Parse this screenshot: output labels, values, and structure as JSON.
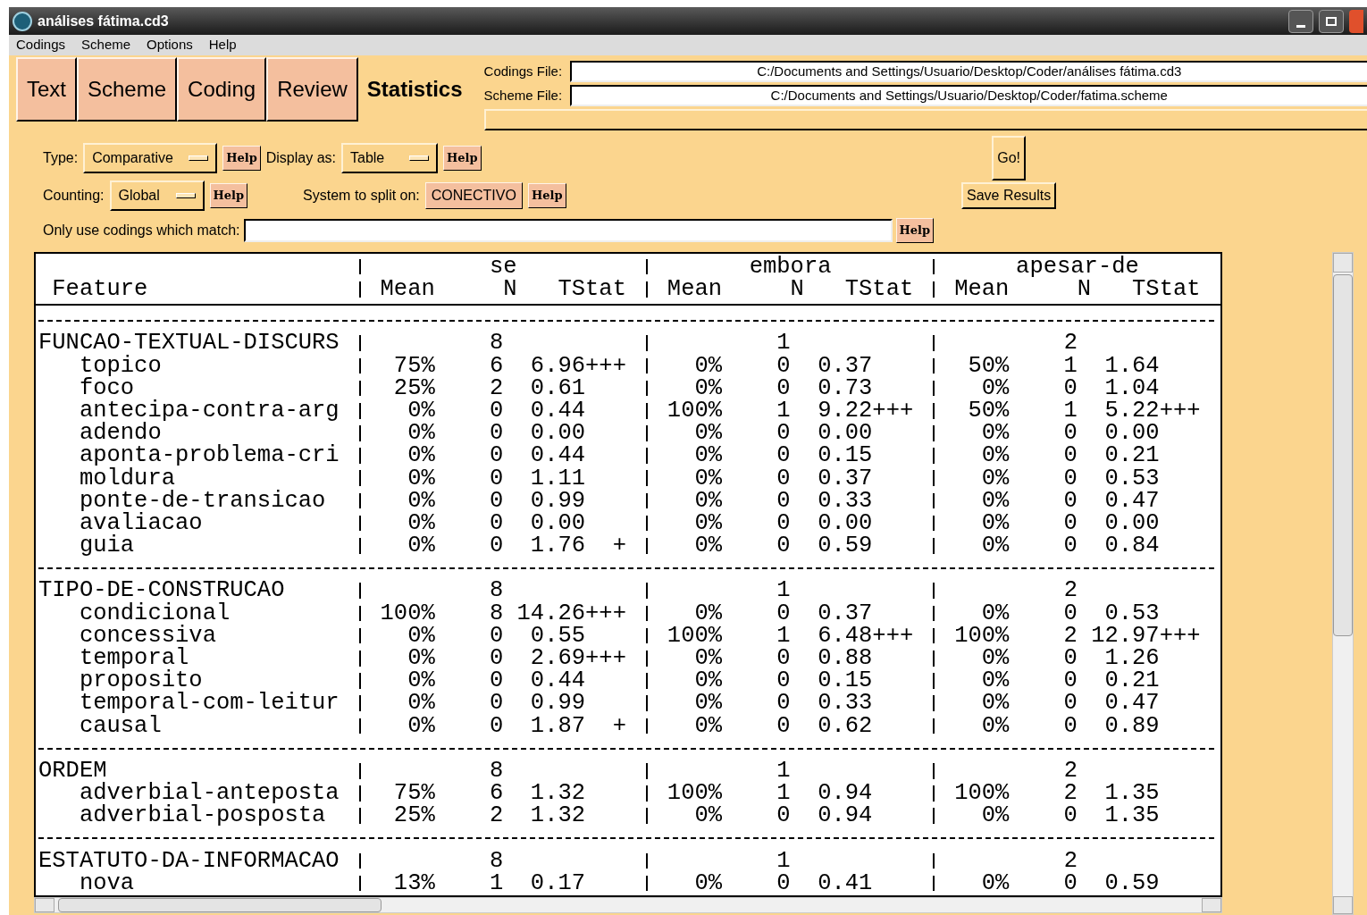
{
  "window": {
    "title": "análises fátima.cd3"
  },
  "menu": [
    "Codings",
    "Scheme",
    "Options",
    "Help"
  ],
  "tabs": [
    {
      "label": "Text",
      "selected": false
    },
    {
      "label": "Scheme",
      "selected": false
    },
    {
      "label": "Coding",
      "selected": false
    },
    {
      "label": "Review",
      "selected": false
    },
    {
      "label": "Statistics",
      "selected": true
    }
  ],
  "files": [
    {
      "label": "Codings File:",
      "value": "C:/Documents and Settings/Usuario/Desktop/Coder/análises fátima.cd3"
    },
    {
      "label": "Scheme File:",
      "value": "C:/Documents and Settings/Usuario/Desktop/Coder/fatima.scheme"
    }
  ],
  "controls": {
    "type_label": "Type:",
    "type_value": "Comparative",
    "display_label": "Display as:",
    "display_value": "Table",
    "counting_label": "Counting:",
    "counting_value": "Global",
    "split_label": "System to split on:",
    "split_value": "CONECTIVO",
    "match_label": "Only use codings which match:",
    "helps": [
      "Help",
      "Help",
      "Help",
      "Help",
      "Help"
    ],
    "go": "Go!",
    "save": "Save Results"
  },
  "table": {
    "feature_heading": "Feature",
    "columns": [
      {
        "name": "se",
        "subheadings": [
          "Mean",
          "N",
          "TStat"
        ]
      },
      {
        "name": "embora",
        "subheadings": [
          "Mean",
          "N",
          "TStat"
        ]
      },
      {
        "name": "apesar-de",
        "subheadings": [
          "Mean",
          "N",
          "TStat"
        ]
      }
    ],
    "groups": [
      {
        "name": "FUNCAO-TEXTUAL-DISCURS",
        "counts": [
          "8",
          "1",
          "2"
        ],
        "rows": [
          {
            "feature": "topico",
            "cells": [
              [
                "75%",
                "6",
                "6.96",
                "+++"
              ],
              [
                "0%",
                "0",
                "0.37"
              ],
              [
                "50%",
                "1",
                "1.64"
              ]
            ]
          },
          {
            "feature": "foco",
            "cells": [
              [
                "25%",
                "2",
                "0.61"
              ],
              [
                "0%",
                "0",
                "0.73"
              ],
              [
                "0%",
                "0",
                "1.04"
              ]
            ]
          },
          {
            "feature": "antecipa-contra-arg",
            "cells": [
              [
                "0%",
                "0",
                "0.44"
              ],
              [
                "100%",
                "1",
                "9.22",
                "+++"
              ],
              [
                "50%",
                "1",
                "5.22",
                "+++"
              ]
            ]
          },
          {
            "feature": "adendo",
            "cells": [
              [
                "0%",
                "0",
                "0.00"
              ],
              [
                "0%",
                "0",
                "0.00"
              ],
              [
                "0%",
                "0",
                "0.00"
              ]
            ]
          },
          {
            "feature": "aponta-problema-cri",
            "cells": [
              [
                "0%",
                "0",
                "0.44"
              ],
              [
                "0%",
                "0",
                "0.15"
              ],
              [
                "0%",
                "0",
                "0.21"
              ]
            ]
          },
          {
            "feature": "moldura",
            "cells": [
              [
                "0%",
                "0",
                "1.11"
              ],
              [
                "0%",
                "0",
                "0.37"
              ],
              [
                "0%",
                "0",
                "0.53"
              ]
            ]
          },
          {
            "feature": "ponte-de-transicao",
            "cells": [
              [
                "0%",
                "0",
                "0.99"
              ],
              [
                "0%",
                "0",
                "0.33"
              ],
              [
                "0%",
                "0",
                "0.47"
              ]
            ]
          },
          {
            "feature": "avaliacao",
            "cells": [
              [
                "0%",
                "0",
                "0.00"
              ],
              [
                "0%",
                "0",
                "0.00"
              ],
              [
                "0%",
                "0",
                "0.00"
              ]
            ]
          },
          {
            "feature": "guia",
            "cells": [
              [
                "0%",
                "0",
                "1.76",
                "+"
              ],
              [
                "0%",
                "0",
                "0.59"
              ],
              [
                "0%",
                "0",
                "0.84"
              ]
            ]
          }
        ]
      },
      {
        "name": "TIPO-DE-CONSTRUCAO",
        "counts": [
          "8",
          "1",
          "2"
        ],
        "rows": [
          {
            "feature": "condicional",
            "cells": [
              [
                "100%",
                "8",
                "14.26",
                "+++"
              ],
              [
                "0%",
                "0",
                "0.37"
              ],
              [
                "0%",
                "0",
                "0.53"
              ]
            ]
          },
          {
            "feature": "concessiva",
            "cells": [
              [
                "0%",
                "0",
                "0.55"
              ],
              [
                "100%",
                "1",
                "6.48",
                "+++"
              ],
              [
                "100%",
                "2",
                "12.97",
                "+++"
              ]
            ]
          },
          {
            "feature": "temporal",
            "cells": [
              [
                "0%",
                "0",
                "2.69",
                "+++"
              ],
              [
                "0%",
                "0",
                "0.88"
              ],
              [
                "0%",
                "0",
                "1.26"
              ]
            ]
          },
          {
            "feature": "proposito",
            "cells": [
              [
                "0%",
                "0",
                "0.44"
              ],
              [
                "0%",
                "0",
                "0.15"
              ],
              [
                "0%",
                "0",
                "0.21"
              ]
            ]
          },
          {
            "feature": "temporal-com-leitur",
            "cells": [
              [
                "0%",
                "0",
                "0.99"
              ],
              [
                "0%",
                "0",
                "0.33"
              ],
              [
                "0%",
                "0",
                "0.47"
              ]
            ]
          },
          {
            "feature": "causal",
            "cells": [
              [
                "0%",
                "0",
                "1.87",
                "+"
              ],
              [
                "0%",
                "0",
                "0.62"
              ],
              [
                "0%",
                "0",
                "0.89"
              ]
            ]
          }
        ]
      },
      {
        "name": "ORDEM",
        "counts": [
          "8",
          "1",
          "2"
        ],
        "rows": [
          {
            "feature": "adverbial-anteposta",
            "cells": [
              [
                "75%",
                "6",
                "1.32"
              ],
              [
                "100%",
                "1",
                "0.94"
              ],
              [
                "100%",
                "2",
                "1.35"
              ]
            ]
          },
          {
            "feature": "adverbial-posposta",
            "cells": [
              [
                "25%",
                "2",
                "1.32"
              ],
              [
                "0%",
                "0",
                "0.94"
              ],
              [
                "0%",
                "0",
                "1.35"
              ]
            ]
          }
        ]
      },
      {
        "name": "ESTATUTO-DA-INFORMACAO",
        "counts": [
          "8",
          "1",
          "2"
        ],
        "rows": [
          {
            "feature": "nova",
            "cells": [
              [
                "13%",
                "1",
                "0.17"
              ],
              [
                "0%",
                "0",
                "0.41"
              ],
              [
                "0%",
                "0",
                "0.59"
              ]
            ]
          }
        ]
      }
    ]
  }
}
